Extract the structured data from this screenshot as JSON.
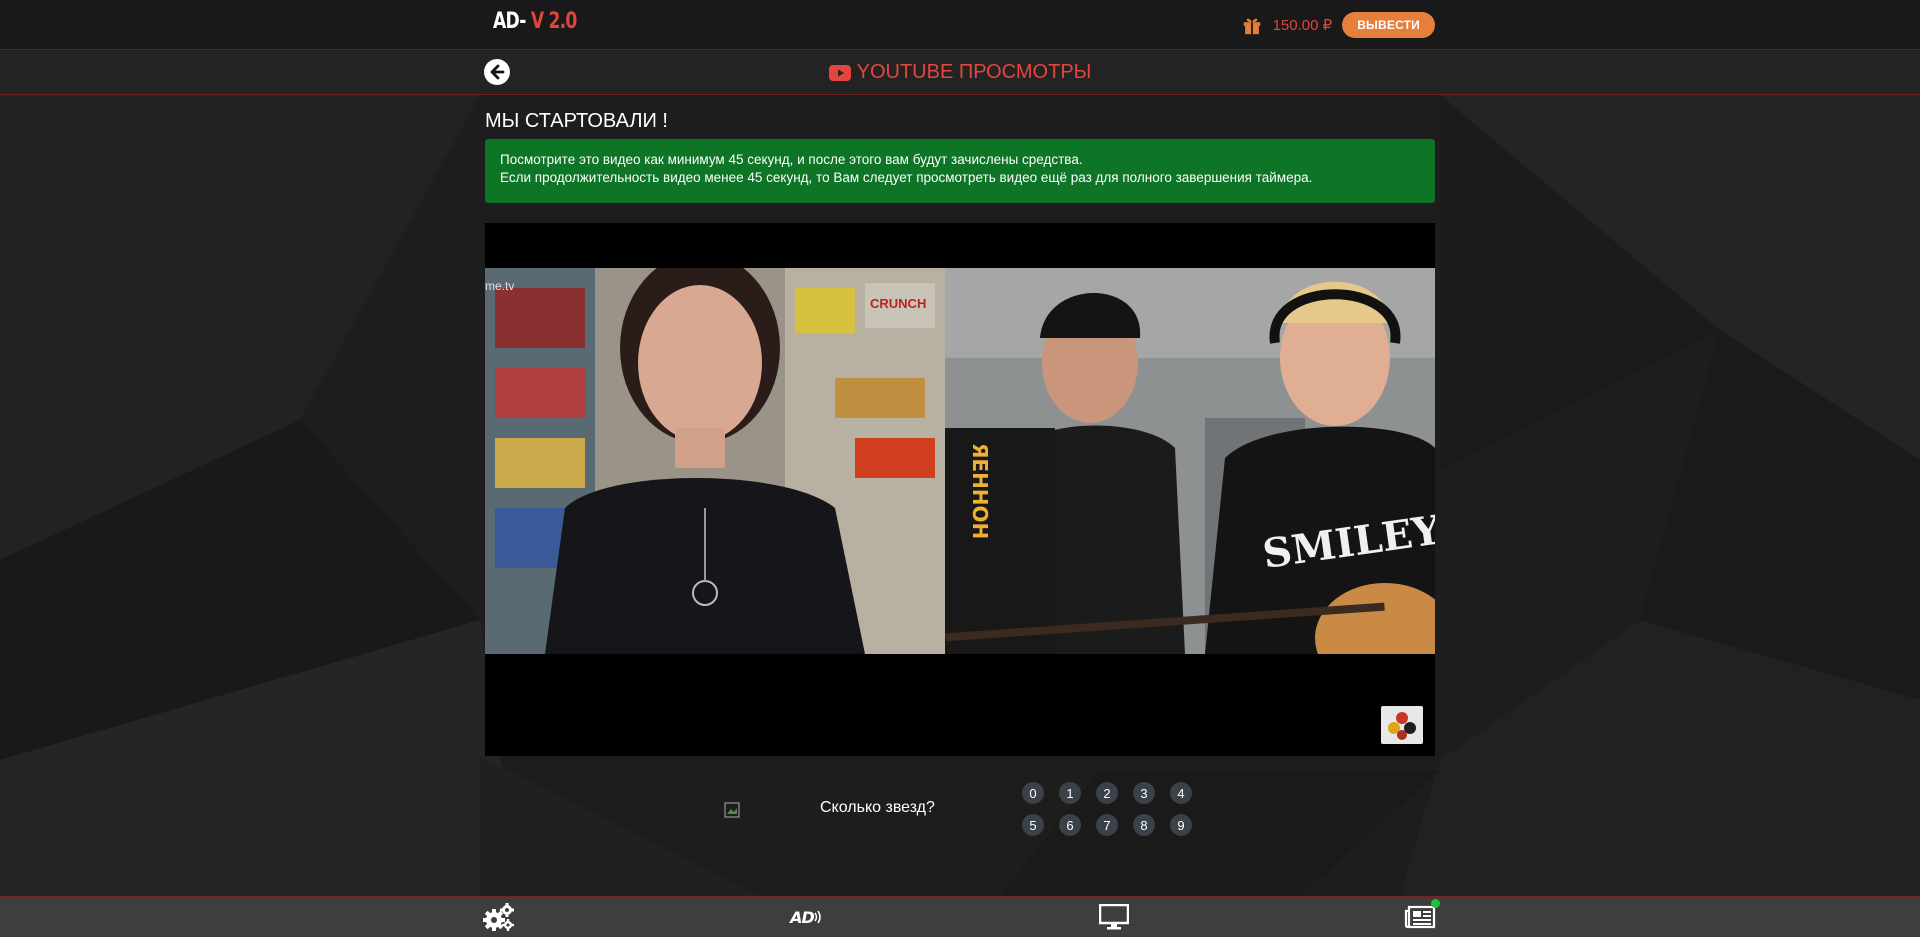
{
  "header": {
    "logo_prefix": "AD-",
    "logo_version": "V 2.0",
    "balance": "150.00 ₽",
    "withdraw_label": "ВЫВЕСТИ",
    "icons": {
      "gift": "gift-icon"
    }
  },
  "titlebar": {
    "title": "YOUTUBE ПРОСМОТРЫ",
    "icons": {
      "back": "arrow-left-circle-icon",
      "youtube": "youtube-icon"
    }
  },
  "content": {
    "heading": "МЫ СТАРТОВАЛИ !",
    "notice_line1": "Посмотрите это видео как минимум 45 секунд, и после этого вам будут зачислены средства.",
    "notice_line2": "Если продолжительность видео менее 45 секунд, то Вам следует просмотреть видео ещё раз для полного завершения таймера."
  },
  "video": {
    "watermark": "me.tv",
    "crunch_label": "CRUNCH",
    "shirt_text": "SMILEY",
    "accordion_text": "ЯЕННОН"
  },
  "captcha": {
    "question": "Сколько звезд?",
    "digits": [
      "0",
      "1",
      "2",
      "3",
      "4",
      "5",
      "6",
      "7",
      "8",
      "9"
    ]
  },
  "bottom_nav": {
    "ad_label": "AD",
    "icons": [
      "gears-icon",
      "ad-logo-icon",
      "monitor-icon",
      "newspaper-icon"
    ]
  },
  "colors": {
    "accent_red": "#e4463d",
    "withdraw_orange": "#e5803c",
    "notice_green": "#0e7526",
    "notif_green": "#1fbf3d"
  }
}
